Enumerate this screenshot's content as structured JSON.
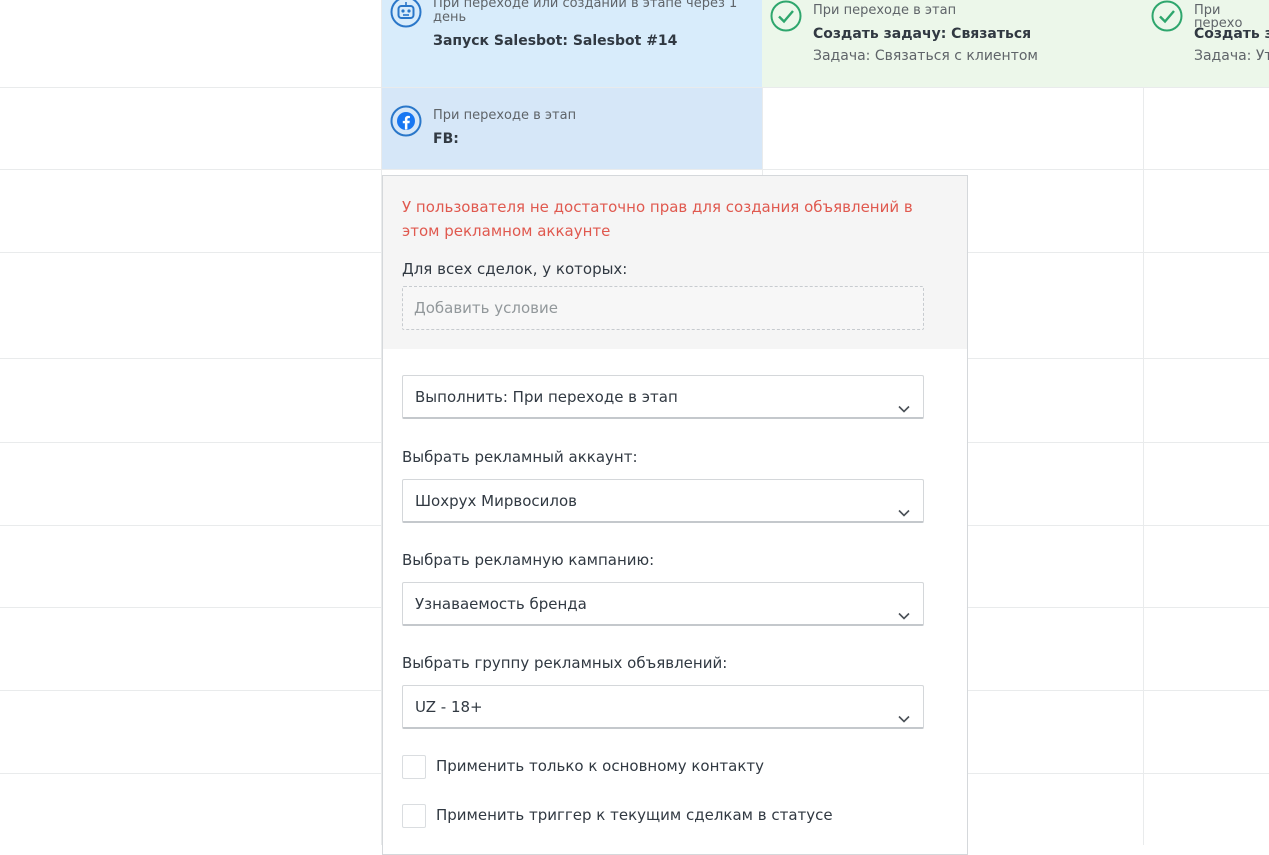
{
  "cards": {
    "salesbot": {
      "icon": "robot-icon",
      "caption_line1": "При переходе или создании в этапе через 1",
      "caption_line2": "день",
      "title": "Запуск Salesbot: Salesbot #14"
    },
    "task1": {
      "icon": "check-circle-icon",
      "caption": "При переходе в этап",
      "title": "Создать задачу: Связаться",
      "subtitle": "Задача: Связаться с клиентом"
    },
    "task2": {
      "icon": "check-circle-icon",
      "caption": "При перехо",
      "title": "Создать за",
      "subtitle": "Задача: Ут"
    },
    "fb": {
      "icon": "facebook-icon",
      "caption": "При переходе в этап",
      "title": "FB:"
    }
  },
  "popup": {
    "error": "У пользователя не достаточно прав для создания объявлений в этом рекламном аккаунте",
    "condition_label": "Для всех сделок, у которых:",
    "add_condition_placeholder": "Добавить условие",
    "execute_select": "Выполнить: При переходе в этап",
    "ad_account_label": "Выбрать рекламный аккаунт:",
    "ad_account_value": "Шохрух Мирвосилов",
    "campaign_label": "Выбрать рекламную кампанию:",
    "campaign_value": "Узнаваемость бренда",
    "adgroup_label": "Выбрать группу рекламных объявлений:",
    "adgroup_value": "UZ - 18+",
    "checkbox_main_contact": "Применить только к основному контакту",
    "checkbox_current_deals": "Применить триггер к текущим сделкам в статусе"
  },
  "colors": {
    "error": "#e0594f",
    "salesbot_bg": "#d8ecfb",
    "task_bg": "#ecf7ea",
    "fb_bg": "#d6e7f8",
    "green_icon": "#2ea66d",
    "blue_icon": "#2a77c9"
  }
}
